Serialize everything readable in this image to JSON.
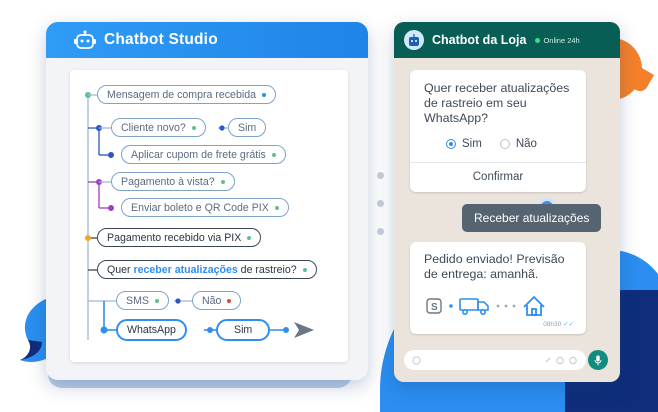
{
  "studio": {
    "title": "Chatbot Studio",
    "nodes": {
      "n1": "Mensagem de compra recebida",
      "n2": "Cliente novo?",
      "n3": "Sim",
      "n4": "Aplicar cupom de frete grátis",
      "n5": "Pagamento à vista?",
      "n6": "Enviar boleto e QR Code PIX",
      "n7": "Pagamento recebido via PIX",
      "n8_pre": "Quer ",
      "n8_hl": "receber atualizações",
      "n8_post": " de rastreio?",
      "n9": "SMS",
      "n10": "Não",
      "n11": "WhatsApp",
      "n12": "Sim"
    }
  },
  "chat": {
    "title": "Chatbot da Loja",
    "status": "Online 24h",
    "question": "Quer receber atualizações de rastreio em seu WhatsApp?",
    "option_yes": "Sim",
    "option_no": "Não",
    "confirm": "Confirmar",
    "reply": "Receber atualizações",
    "message": "Pedido enviado! Previsão de entrega: amanhã.",
    "time": "08h30"
  },
  "colors": {
    "brand_blue": "#2f8ef0",
    "whatsapp_green": "#085e54",
    "accent_orange": "#f5802a",
    "navy": "#0f2d7a"
  }
}
